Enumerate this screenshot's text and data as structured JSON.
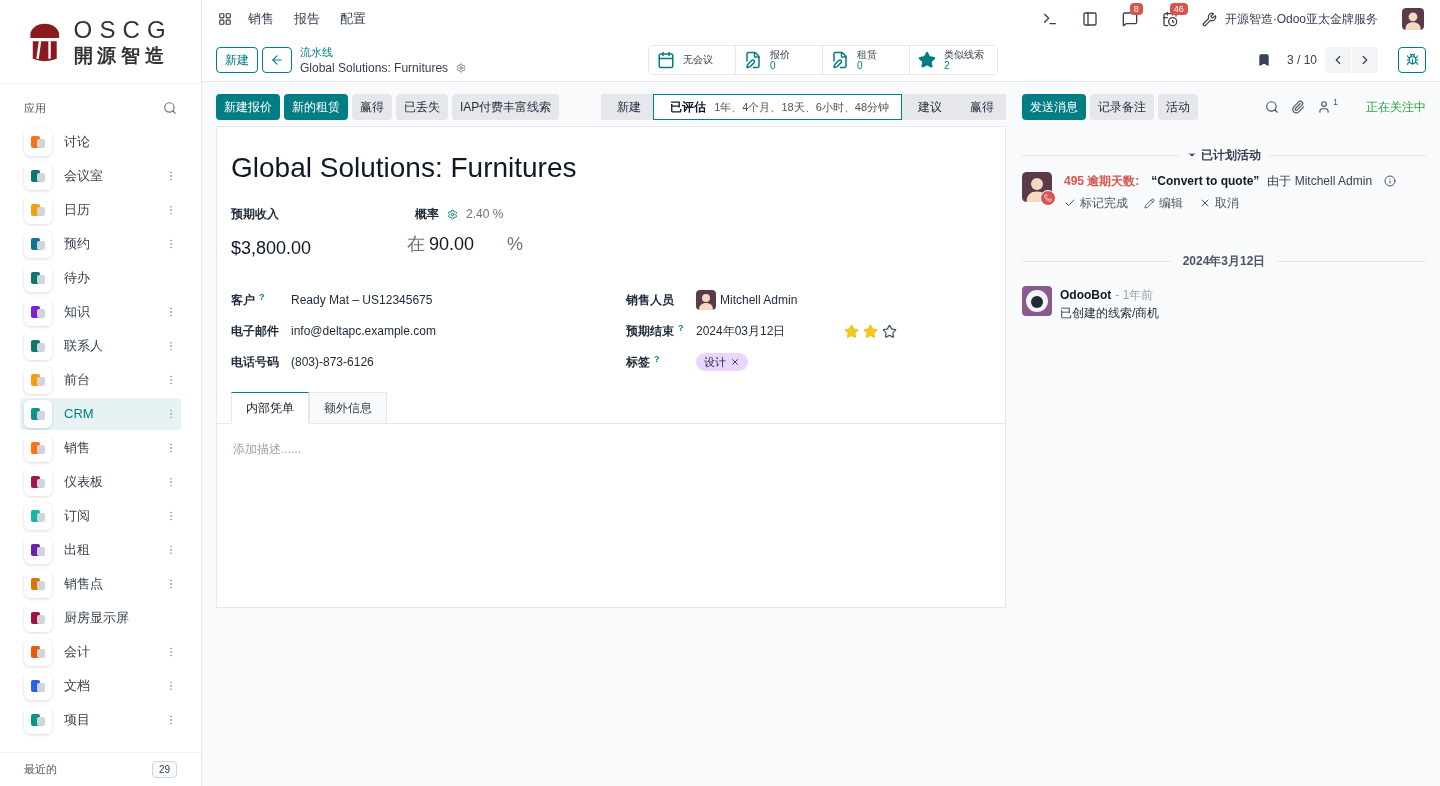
{
  "brand": {
    "name": "OSCG",
    "subtitle": "開源智造"
  },
  "sidebar": {
    "heading": "应用",
    "items": [
      {
        "label": "讨论",
        "color": "#f97316",
        "menu": false,
        "selected": false
      },
      {
        "label": "会议室",
        "color": "#0f766e",
        "menu": true,
        "selected": false
      },
      {
        "label": "日历",
        "color": "#f59e0b",
        "menu": true,
        "selected": false
      },
      {
        "label": "预约",
        "color": "#0e7490",
        "menu": true,
        "selected": false
      },
      {
        "label": "待办",
        "color": "#0f766e",
        "menu": false,
        "selected": false
      },
      {
        "label": "知识",
        "color": "#7e22ce",
        "menu": true,
        "selected": false
      },
      {
        "label": "联系人",
        "color": "#0f766e",
        "menu": true,
        "selected": false
      },
      {
        "label": "前台",
        "color": "#f59e0b",
        "menu": true,
        "selected": false
      },
      {
        "label": "CRM",
        "color": "#0d9488",
        "menu": true,
        "selected": true
      },
      {
        "label": "销售",
        "color": "#f97316",
        "menu": true,
        "selected": false
      },
      {
        "label": "仪表板",
        "color": "#9d174d",
        "menu": true,
        "selected": false
      },
      {
        "label": "订阅",
        "color": "#14b8a6",
        "menu": true,
        "selected": false
      },
      {
        "label": "出租",
        "color": "#6b21a8",
        "menu": true,
        "selected": false
      },
      {
        "label": "销售点",
        "color": "#d97706",
        "menu": true,
        "selected": false
      },
      {
        "label": "厨房显示屏",
        "color": "#9f1239",
        "menu": false,
        "selected": false
      },
      {
        "label": "会计",
        "color": "#ea580c",
        "menu": true,
        "selected": false
      },
      {
        "label": "文档",
        "color": "#2563eb",
        "menu": true,
        "selected": false
      },
      {
        "label": "项目",
        "color": "#0d9488",
        "menu": true,
        "selected": false
      }
    ],
    "footer": {
      "label": "最近的",
      "count": "29"
    }
  },
  "top_menu": [
    "销售",
    "报告",
    "配置"
  ],
  "systray": {
    "messages_badge": "8",
    "activities_badge": "46",
    "company": "开源智造·Odoo亚太金牌服务"
  },
  "breadcrumb": {
    "new_button": "新建",
    "parent": "流水线",
    "current": "Global Solutions: Furnitures"
  },
  "smart_buttons": [
    {
      "kind": "calendar",
      "label": "无会议"
    },
    {
      "kind": "document",
      "label": "报价",
      "count": "0"
    },
    {
      "kind": "document",
      "label": "租赁",
      "count": "0"
    },
    {
      "kind": "star",
      "label": "类似线索",
      "count": "2"
    }
  ],
  "pager": "3 / 10",
  "actions": [
    {
      "label": "新建报价",
      "primary": true
    },
    {
      "label": "新的租赁",
      "primary": true
    },
    {
      "label": "赢得",
      "primary": false
    },
    {
      "label": "已丢失",
      "primary": false
    },
    {
      "label": "IAP付费丰富线索",
      "primary": false
    }
  ],
  "stages": [
    {
      "label": "新建",
      "selected": false
    },
    {
      "label": "已评估",
      "selected": true,
      "duration": "1年、4个月、18天、6小时、48分钟"
    },
    {
      "label": "建议",
      "selected": false
    },
    {
      "label": "赢得",
      "selected": false
    }
  ],
  "form": {
    "title": "Global Solutions: Furnitures",
    "revenue_label": "预期收入",
    "revenue": "$3,800.00",
    "probability_label": "概率",
    "auto_probability": "2.40 %",
    "at": "在",
    "probability": "90.00",
    "percent": "%",
    "fields_left": [
      {
        "label": "客户",
        "help": "?",
        "value": "Ready Mat – US12345675"
      },
      {
        "label": "电子邮件",
        "value": "info@deltapc.example.com"
      },
      {
        "label": "电话号码",
        "value": "(803)-873-6126"
      }
    ],
    "salesperson": {
      "label": "销售人员",
      "value": "Mitchell Admin"
    },
    "deadline": {
      "label": "预期结束",
      "help": "?",
      "value": "2024年03月12日",
      "stars": 2
    },
    "tags": {
      "label": "标签",
      "help": "?",
      "items": [
        {
          "label": "设计",
          "color": "#e9d5ff"
        }
      ]
    },
    "tabs": [
      {
        "label": "内部凭单",
        "selected": true
      },
      {
        "label": "额外信息",
        "selected": false
      }
    ],
    "notes_placeholder": "添加描述......"
  },
  "chatter": {
    "buttons": [
      {
        "label": "发送消息",
        "primary": true
      },
      {
        "label": "记录备注",
        "primary": false
      },
      {
        "label": "活动",
        "primary": false
      }
    ],
    "followers": "1",
    "following": "正在关注中",
    "activities_heading": "已计划活动",
    "activity": {
      "overdue": "495 逾期天数:",
      "summary": "“Convert to quote”",
      "by": "由于 Mitchell Admin",
      "actions": [
        {
          "kind": "check",
          "label": "标记完成"
        },
        {
          "kind": "edit",
          "label": "编辑"
        },
        {
          "kind": "cancel",
          "label": "取消"
        }
      ]
    },
    "date_separator": "2024年3月12日",
    "message": {
      "author": "OdooBot",
      "time": "- 1年前",
      "body": "已创建的线索/商机"
    }
  }
}
